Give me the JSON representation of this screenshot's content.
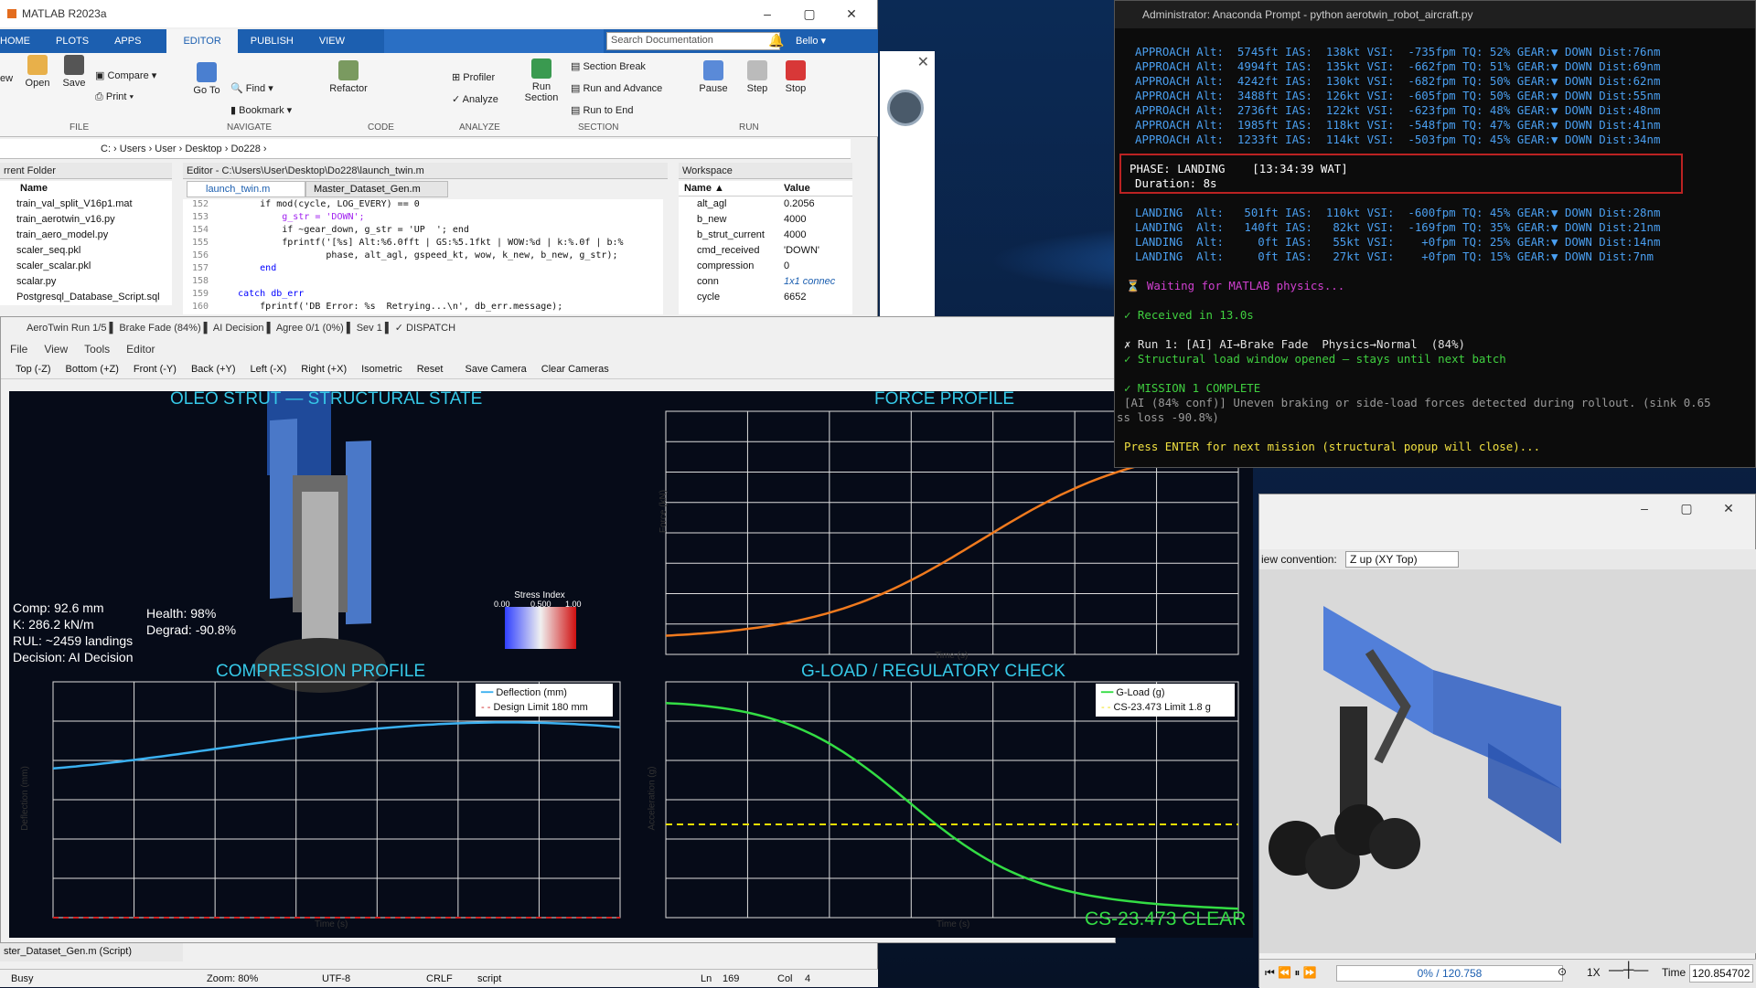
{
  "matlab": {
    "title": "MATLAB R2023a",
    "tabs": [
      "HOME",
      "PLOTS",
      "APPS",
      "EDITOR",
      "PUBLISH",
      "VIEW"
    ],
    "search_placeholder": "Search Documentation",
    "user": "Bello ▾",
    "ribbon": {
      "file": [
        "ew",
        "Open",
        "Save",
        "Compare ▾",
        "Print ▾"
      ],
      "navigate": [
        "Go To",
        "Find ▾",
        "Bookmark ▾"
      ],
      "code": [
        "Refactor"
      ],
      "analyze": [
        "Profiler",
        "Analyze"
      ],
      "section": [
        "Run Section",
        "Section Break",
        "Run and Advance",
        "Run to End"
      ],
      "run": [
        "Pause",
        "Step",
        "Stop"
      ],
      "groups": [
        "FILE",
        "NAVIGATE",
        "CODE",
        "ANALYZE",
        "SECTION",
        "RUN"
      ]
    },
    "path": [
      "C:",
      "Users",
      "User",
      "Desktop",
      "Do228"
    ],
    "current_folder": {
      "header": "rrent Folder",
      "col": "Name",
      "files": [
        "train_val_split_V16p1.mat",
        "train_aerotwin_v16.py",
        "train_aero_model.py",
        "scaler_seq.pkl",
        "scaler_scalar.pkl",
        "scalar.py",
        "Postgresql_Database_Script.sql"
      ]
    },
    "editor": {
      "header": "Editor - C:\\Users\\User\\Desktop\\Do228\\launch_twin.m",
      "tabs": [
        "launch_twin.m",
        "Master_Dataset_Gen.m"
      ],
      "lines": [
        {
          "n": "152",
          "c": "        if mod(cycle, LOG_EVERY) == 0"
        },
        {
          "n": "153",
          "c": "            g_str = 'DOWN';"
        },
        {
          "n": "154",
          "c": "            if ~gear_down, g_str = 'UP  '; end"
        },
        {
          "n": "155",
          "c": "            fprintf('[%s] Alt:%6.0fft | GS:%5.1fkt | WOW:%d | k:%.0f | b:%"
        },
        {
          "n": "156",
          "c": "                    phase, alt_agl, gspeed_kt, wow, k_new, b_new, g_str);"
        },
        {
          "n": "157",
          "c": "        end"
        },
        {
          "n": "158",
          "c": ""
        },
        {
          "n": "159",
          "c": "    catch db_err"
        },
        {
          "n": "160",
          "c": "        fprintf('DB Error: %s  Retrying...\\n', db_err.message);"
        }
      ]
    },
    "workspace": {
      "header": "Workspace",
      "cols": [
        "Name ▲",
        "Value"
      ],
      "vars": [
        {
          "name": "alt_agl",
          "value": "0.2056"
        },
        {
          "name": "b_new",
          "value": "4000"
        },
        {
          "name": "b_strut_current",
          "value": "4000"
        },
        {
          "name": "cmd_received",
          "value": "'DOWN'"
        },
        {
          "name": "compression",
          "value": "0"
        },
        {
          "name": "conn",
          "value": "1x1 connec"
        },
        {
          "name": "cycle",
          "value": "6652"
        }
      ]
    },
    "footer_file": "ster_Dataset_Gen.m  (Script)",
    "status": {
      "state": "Busy",
      "zoom": "Zoom: 80%",
      "enc": "UTF-8",
      "eol": "CRLF",
      "type": "script",
      "ln": "Ln",
      "ln_val": "169",
      "col": "Col",
      "col_val": "4"
    }
  },
  "aerotwin": {
    "title": "AeroTwin Run 1/5  ▌ Brake Fade  (84%)  ▌ AI Decision  ▌ Agree 0/1 (0%)  ▌ Sev 1  ▌ ✓ DISPATCH",
    "menu": [
      "File",
      "View",
      "Tools",
      "Editor"
    ],
    "toolbar": [
      "Top (-Z)",
      "Bottom (+Z)",
      "Front (-Y)",
      "Back (+Y)",
      "Left (-X)",
      "Right (+X)",
      "Isometric",
      "Reset",
      "Save Camera",
      "Clear Cameras"
    ],
    "strut": {
      "title": "OLEO STRUT — STRUCTURAL STATE",
      "comp": "Comp: 92.6 mm",
      "k": "K: 286.2 kN/m",
      "rul": "RUL: ~2459 landings",
      "decision": "Decision: AI Decision",
      "health": "Health: 98%",
      "degrad": "Degrad: -90.8%",
      "stress_title": "Stress Index",
      "stress_ticks": [
        "0.00",
        "0.500",
        "1.00"
      ]
    },
    "force": {
      "title": "FORCE PROFILE",
      "ylabel": "Force (kN)",
      "xlabel": "Time (s)"
    },
    "compression": {
      "title": "COMPRESSION PROFILE",
      "ylabel": "Deflection (mm)",
      "xlabel": "Time (s)",
      "legend": [
        "Deflection (mm)",
        "Design Limit 180 mm"
      ]
    },
    "gload": {
      "title": "G-LOAD / REGULATORY CHECK",
      "ylabel": "Acceleration (g)",
      "xlabel": "Time (s)",
      "legend": [
        "G-Load (g)",
        "CS-23.473 Limit 1.8 g"
      ],
      "verdict": "CS-23.473 CLEAR"
    },
    "colors": {
      "accent": "#36c9e8",
      "force": "#f07a1e",
      "deflection": "#3ab0f0",
      "limit_red": "#d02020",
      "gload": "#33dd44",
      "limit_yellow": "#f0e000"
    }
  },
  "terminal": {
    "title": "Administrator: Anaconda Prompt - python  aerotwin_robot_aircraft.py",
    "approach": [
      "APPROACH Alt:  5745ft IAS:  138kt VSI:  -735fpm TQ: 52% GEAR:▼ DOWN Dist:76nm",
      "APPROACH Alt:  4994ft IAS:  135kt VSI:  -662fpm TQ: 51% GEAR:▼ DOWN Dist:69nm",
      "APPROACH Alt:  4242ft IAS:  130kt VSI:  -682fpm TQ: 50% GEAR:▼ DOWN Dist:62nm",
      "APPROACH Alt:  3488ft IAS:  126kt VSI:  -605fpm TQ: 50% GEAR:▼ DOWN Dist:55nm",
      "APPROACH Alt:  2736ft IAS:  122kt VSI:  -623fpm TQ: 48% GEAR:▼ DOWN Dist:48nm",
      "APPROACH Alt:  1985ft IAS:  118kt VSI:  -548fpm TQ: 47% GEAR:▼ DOWN Dist:41nm",
      "APPROACH Alt:  1233ft IAS:  114kt VSI:  -503fpm TQ: 45% GEAR:▼ DOWN Dist:34nm"
    ],
    "phase": "PHASE: LANDING    [13:34:39 WAT]",
    "duration": "Duration: 8s",
    "landing": [
      "LANDING  Alt:   501ft IAS:  110kt VSI:  -600fpm TQ: 45% GEAR:▼ DOWN Dist:28nm",
      "LANDING  Alt:   140ft IAS:   82kt VSI:  -169fpm TQ: 35% GEAR:▼ DOWN Dist:21nm",
      "LANDING  Alt:     0ft IAS:   55kt VSI:    +0fpm TQ: 25% GEAR:▼ DOWN Dist:14nm",
      "LANDING  Alt:     0ft IAS:   27kt VSI:    +0fpm TQ: 15% GEAR:▼ DOWN Dist:7nm"
    ],
    "waiting": "⏳ Waiting for MATLAB physics...",
    "received": "✓ Received in 13.0s",
    "run": "✗ Run 1: [AI] AI→Brake Fade  Physics→Normal  (84%)",
    "structural": "✓ Structural load window opened — stays until next batch",
    "mission": "✓ MISSION 1 COMPLETE",
    "ai_note1": "[AI (84% conf)] Uneven braking or side-load forces detected during rollout. (sink 0.65",
    "ai_note2": "ss loss -90.8%)",
    "enter": "Press ENTER for next mission (structural popup will close)..."
  },
  "viewer": {
    "view_label": "iew convention:",
    "view_value": "Z up (XY Top)",
    "progress": "0% / 120.758",
    "speed": "1X",
    "time_label": "Time",
    "time_value": "120.854702"
  }
}
